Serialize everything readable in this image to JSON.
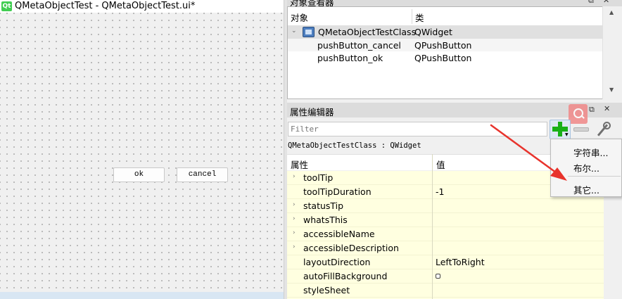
{
  "form": {
    "icon_text": "Qt",
    "title": "QMetaObjectTest - QMetaObjectTest.ui*",
    "ok_label": "ok",
    "cancel_label": "cancel"
  },
  "object_inspector": {
    "title": "对象查看器",
    "columns": [
      "对象",
      "类"
    ],
    "rows": [
      {
        "object": "QMetaObjectTestClass",
        "class": "QWidget"
      },
      {
        "object": "pushButton_cancel",
        "class": "QPushButton"
      },
      {
        "object": "pushButton_ok",
        "class": "QPushButton"
      }
    ]
  },
  "property_editor": {
    "title": "属性编辑器",
    "filter_placeholder": "Filter",
    "class_label": "QMetaObjectTestClass : QWidget",
    "columns": [
      "属性",
      "值"
    ],
    "properties": [
      {
        "name": "toolTip",
        "value": "",
        "expandable": true
      },
      {
        "name": "toolTipDuration",
        "value": "-1",
        "expandable": false
      },
      {
        "name": "statusTip",
        "value": "",
        "expandable": true
      },
      {
        "name": "whatsThis",
        "value": "",
        "expandable": true
      },
      {
        "name": "accessibleName",
        "value": "",
        "expandable": true
      },
      {
        "name": "accessibleDescription",
        "value": "",
        "expandable": true
      },
      {
        "name": "layoutDirection",
        "value": "LeftToRight",
        "expandable": false
      },
      {
        "name": "autoFillBackground",
        "value": "",
        "expandable": false
      },
      {
        "name": "styleSheet",
        "value": "",
        "expandable": false
      }
    ]
  },
  "add_menu": {
    "items": [
      "字符串...",
      "布尔...",
      "其它..."
    ]
  },
  "icons": {
    "dock_float": "⧉",
    "dock_close": "✕",
    "expander": "›",
    "tree_expanded": "⌄",
    "scroll_up": "▲",
    "scroll_down": "▼"
  },
  "colors": {
    "property_row_bg": "#ffffe0",
    "selected_row_bg": "#e0e0e0",
    "annotation_arrow": "#e8332c",
    "add_plus": "#18b018"
  }
}
